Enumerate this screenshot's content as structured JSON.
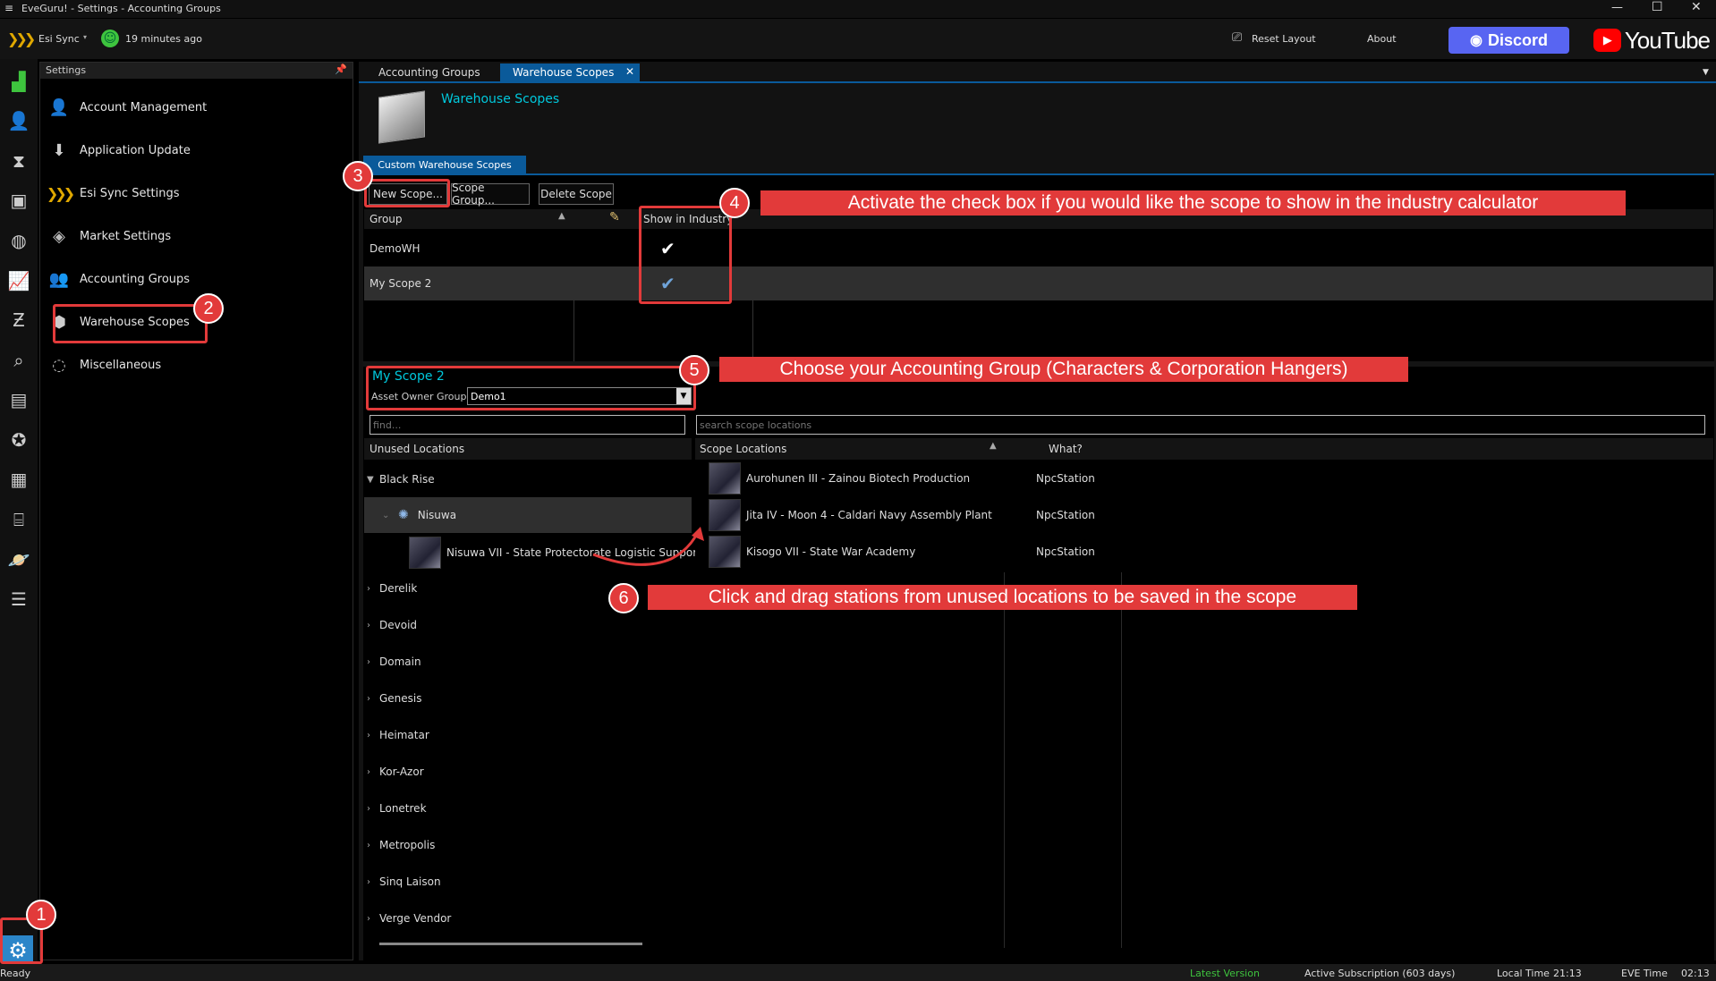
{
  "window": {
    "title": "EveGuru! - Settings - Accounting Groups"
  },
  "toolbar": {
    "esi_sync": "Esi Sync",
    "sync_time": "19 minutes ago",
    "reset_layout": "Reset Layout",
    "about": "About",
    "discord": "Discord",
    "youtube": "YouTube"
  },
  "settings_panel": {
    "title": "Settings",
    "items": [
      {
        "label": "Account Management",
        "icon": "user-icon"
      },
      {
        "label": "Application Update",
        "icon": "download-icon"
      },
      {
        "label": "Esi Sync Settings",
        "icon": "chevrons-icon"
      },
      {
        "label": "Market Settings",
        "icon": "tag-icon"
      },
      {
        "label": "Accounting Groups",
        "icon": "users-icon"
      },
      {
        "label": "Warehouse Scopes",
        "icon": "box-icon"
      },
      {
        "label": "Miscellaneous",
        "icon": "spinner-icon"
      }
    ]
  },
  "tabs": [
    {
      "label": "Accounting Groups"
    },
    {
      "label": "Warehouse Scopes"
    }
  ],
  "page": {
    "title": "Warehouse Scopes",
    "subtab": "Custom Warehouse Scopes",
    "buttons": {
      "new": "New Scope...",
      "group": "Scope Group...",
      "delete": "Delete Scope"
    },
    "grid": {
      "col_group": "Group",
      "col_show": "Show in Industry",
      "rows": [
        {
          "name": "DemoWH"
        },
        {
          "name": "My Scope 2"
        }
      ]
    },
    "detail": {
      "scope_name": "My Scope 2",
      "owner_label": "Asset Owner Group",
      "owner_value": "Demo1",
      "find_placeholder": "find...",
      "search_placeholder": "search scope locations",
      "unused_header": "Unused Locations",
      "scope_header": "Scope Locations",
      "what_header": "What?"
    },
    "tree": {
      "root": "Black Rise",
      "child": "Nisuwa",
      "station": "Nisuwa VII - State Protectorate Logistic Support",
      "regions": [
        "Derelik",
        "Devoid",
        "Domain",
        "Genesis",
        "Heimatar",
        "Kor-Azor",
        "Lonetrek",
        "Metropolis",
        "Sinq Laison",
        "Verge Vendor"
      ]
    },
    "scope_locations": [
      {
        "name": "Aurohunen III - Zainou Biotech Production",
        "what": "NpcStation"
      },
      {
        "name": "Jita IV - Moon 4 - Caldari Navy Assembly Plant",
        "what": "NpcStation"
      },
      {
        "name": "Kisogo VII - State War Academy",
        "what": "NpcStation"
      }
    ]
  },
  "callouts": {
    "c1": "1",
    "c2": "2",
    "c3": "3",
    "c4": "4",
    "c5": "5",
    "c6": "6",
    "t4": "Activate the check box if you would like the scope to show in the industry calculator",
    "t5": "Choose your Accounting Group (Characters & Corporation Hangers)",
    "t6": "Click and drag stations from unused locations to be saved in the scope"
  },
  "status": {
    "ready": "Ready",
    "latest": "Latest Version",
    "subscription": "Active Subscription (603 days)",
    "local_time_label": "Local Time",
    "local_time": "21:13",
    "eve_time_label": "EVE Time",
    "eve_time": "02:13"
  },
  "colors": {
    "accent": "#00b4c8",
    "callout": "#e23a3a",
    "tab_active": "#0a5a9a",
    "discord": "#5865f2",
    "youtube": "#ff0000"
  }
}
